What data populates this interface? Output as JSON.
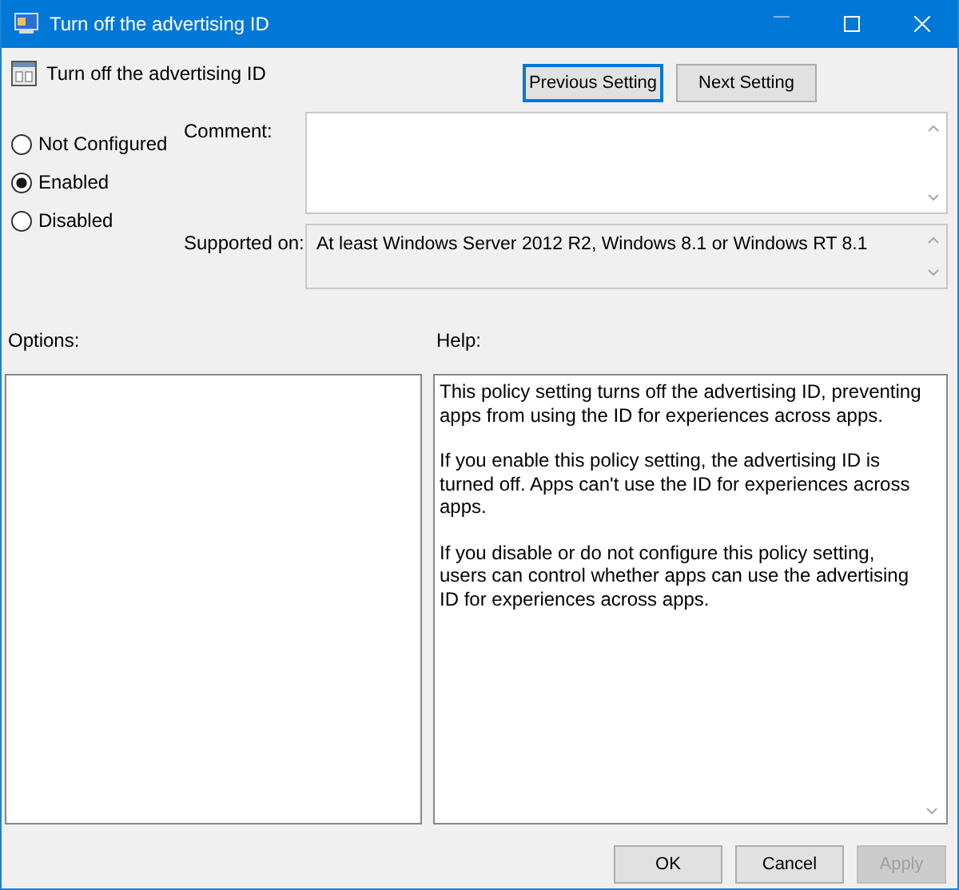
{
  "window": {
    "title": "Turn off the advertising ID"
  },
  "setting": {
    "name": "Turn off the advertising ID"
  },
  "navigation": [
    {
      "label": "Previous Setting",
      "focused": true
    },
    {
      "label": "Next Setting",
      "focused": false
    }
  ],
  "state_options": [
    {
      "label": "Not Configured",
      "selected": false
    },
    {
      "label": "Enabled",
      "selected": true
    },
    {
      "label": "Disabled",
      "selected": false
    }
  ],
  "comment": {
    "label": "Comment:"
  },
  "supported_on": {
    "label": "Supported on:",
    "value": "At least Windows Server 2012 R2, Windows 8.1 or Windows RT 8.1"
  },
  "options": {
    "label": "Options:"
  },
  "help": {
    "label": "Help:",
    "paragraphs": [
      "This policy setting turns off the advertising ID, preventing apps from using the ID for experiences across apps.",
      "If you enable this policy setting, the advertising ID is turned off. Apps can't use the ID for experiences across apps.",
      "If you disable or do not configure this policy setting, users can control whether apps can use the advertising ID for experiences across apps."
    ]
  },
  "buttons": [
    {
      "label": "OK",
      "disabled": false
    },
    {
      "label": "Cancel",
      "disabled": false
    },
    {
      "label": "Apply",
      "disabled": true
    }
  ]
}
